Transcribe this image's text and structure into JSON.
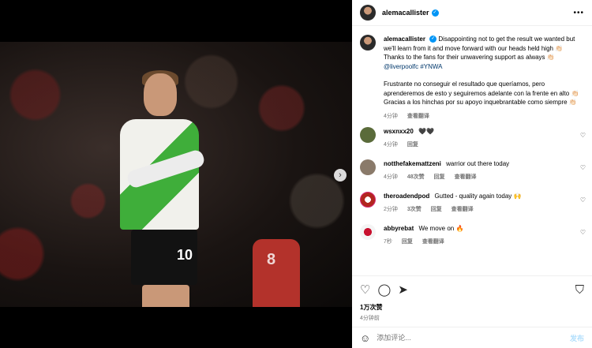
{
  "post": {
    "username": "alemacallister",
    "caption": {
      "line1": "Disappointing not to get the result we wanted but we'll learn from it and move forward with our heads held high 👏🏻",
      "line2": "Thanks to the fans for their unwavering support as always 👏🏻",
      "tags": "@liverpoolfc #YNWA",
      "line3": "Frustrante no conseguir el resultado que queríamos, pero aprenderemos de esto y seguiremos adelante con la frente en alto 👏🏻",
      "line4": "Gracias a los hinchas por su apoyo inquebrantable como siempre 👏🏻"
    },
    "caption_time": "4分钟",
    "see_translation": "查看翻译",
    "likes": "1万次赞",
    "time_ago": "4分钟前"
  },
  "comments": [
    {
      "user": "wsxnxx20",
      "text": "🖤🖤",
      "time": "4分钟",
      "likes": "",
      "reply": "回复",
      "translate": ""
    },
    {
      "user": "notthefakemattzeni",
      "text": "warrior out there today",
      "time": "4分钟",
      "likes": "48次赞",
      "reply": "回复",
      "translate": "查看翻译"
    },
    {
      "user": "theroadendpod",
      "text": "Gutted - quality again today 🙌",
      "time": "2分钟",
      "likes": "3次赞",
      "reply": "回复",
      "translate": "查看翻译"
    },
    {
      "user": "abbyrebat",
      "text": "We move on 🔥",
      "time": "7秒",
      "likes": "",
      "reply": "回复",
      "translate": "查看翻译"
    }
  ],
  "comment_input": {
    "placeholder": "添加评论...",
    "post_label": "发布"
  },
  "photo": {
    "shirt_number": "10",
    "bg_number": "8"
  },
  "icons": {
    "like": "heart-icon",
    "comment": "comment-icon",
    "share": "share-icon",
    "save": "bookmark-icon",
    "emoji": "emoji-icon",
    "next": "chevron-right-icon",
    "more": "more-icon"
  },
  "colors": {
    "link": "#00376b",
    "verified": "#0095f6",
    "post_button": "#b2dffc"
  }
}
